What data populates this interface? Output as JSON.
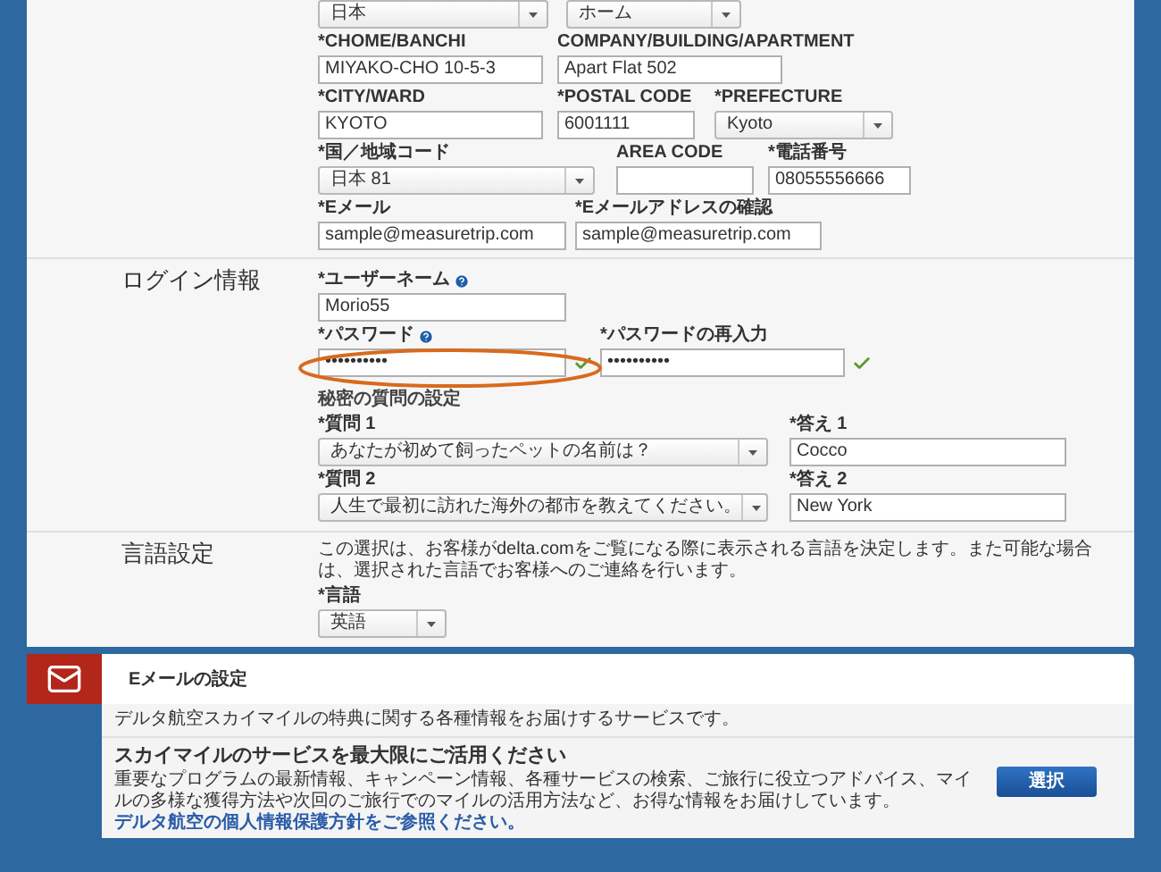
{
  "address_top": [
    {
      "kind": "select",
      "value": "日本"
    },
    {
      "kind": "select",
      "value": "ホーム"
    }
  ],
  "address_rows": [
    [
      {
        "kind": "input",
        "label": "*CHOME/BANCHI",
        "value": "MIYAKO-CHO 10-5-3"
      },
      {
        "kind": "input",
        "label": "COMPANY/BUILDING/APARTMENT",
        "value": "Apart Flat 502"
      }
    ],
    [
      {
        "kind": "input",
        "label": "*CITY/WARD",
        "value": "KYOTO"
      },
      {
        "kind": "input",
        "label": "*POSTAL CODE",
        "value": "6001111"
      },
      {
        "kind": "select",
        "label": "*PREFECTURE",
        "value": "Kyoto"
      }
    ],
    [
      {
        "kind": "select",
        "label": "*国／地域コード",
        "value": "日本 81"
      },
      {
        "kind": "input",
        "label": "AREA CODE"
      },
      {
        "kind": "input",
        "label": "*電話番号",
        "value": "08055556666"
      }
    ],
    [
      {
        "kind": "input",
        "label": "*Eメール",
        "value": "sample@measuretrip.com"
      },
      {
        "kind": "input",
        "label": "*Eメールアドレスの確認",
        "value": "sample@measuretrip.com"
      }
    ]
  ],
  "login": {
    "title": "ログイン情報",
    "username": {
      "label": "*ユーザーネーム",
      "value": "Morio55",
      "help": true
    },
    "password": {
      "label": "*パスワード",
      "value": "••••••••••",
      "help": true,
      "valid": true
    },
    "password_confirm": {
      "label": "*パスワードの再入力",
      "value": "••••••••••",
      "valid": true
    },
    "secret_title": "秘密の質問の設定",
    "questions": [
      {
        "label": "*質問 1",
        "value": "あなたが初めて飼ったペットの名前は？",
        "answer_label": "*答え 1",
        "answer": "Cocco"
      },
      {
        "label": "*質問 2",
        "value": "人生で最初に訪れた海外の都市を教えてください。",
        "answer_label": "*答え 2",
        "answer": "New York"
      }
    ]
  },
  "language": {
    "title": "言語設定",
    "description": "この選択は、お客様がdelta.comをご覧になる際に表示される言語を決定します。また可能な場合は、選択された言語でお客様へのご連絡を行います。",
    "label": "*言語",
    "value": "英語"
  },
  "email_settings": {
    "title": "Eメールの設定",
    "intro": "デルタ航空スカイマイルの特典に関する各種情報をお届けするサービスです。",
    "heading": "スカイマイルのサービスを最大限にご活用ください",
    "description": "重要なプログラムの最新情報、キャンペーン情報、各種サービスの検索、ご旅行に役立つアドバイス、マイルの多様な獲得方法や次回のご旅行でのマイルの活用方法など、お得な情報をお届けしています。",
    "link": "デルタ航空の個人情報保護方針をご参照ください。",
    "button": "選択"
  }
}
